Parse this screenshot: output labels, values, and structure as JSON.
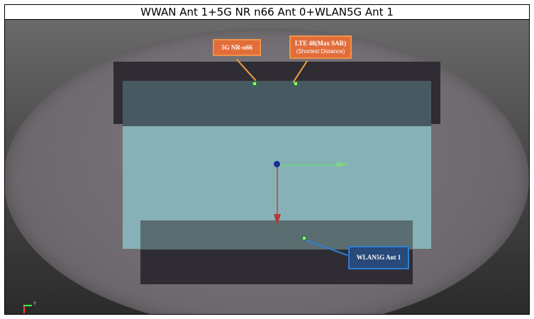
{
  "window": {
    "title": "WWAN Ant 1+5G NR n66 Ant 0+WLAN5G Ant 1"
  },
  "labels": {
    "nr_n66": "5G NR-n66",
    "lte48_title": "LTE 48(Max SAR)",
    "lte48_sub": "(Shortest Distance)",
    "wlan5g": "WLAN5G Ant 1"
  },
  "mini_axes": {
    "y_label": "Y"
  },
  "colors": {
    "marker_point": "#8dff7a",
    "orange_callout": "#e26d3a",
    "blue_callout": "#284a7a",
    "screen": "#86b2b7"
  }
}
